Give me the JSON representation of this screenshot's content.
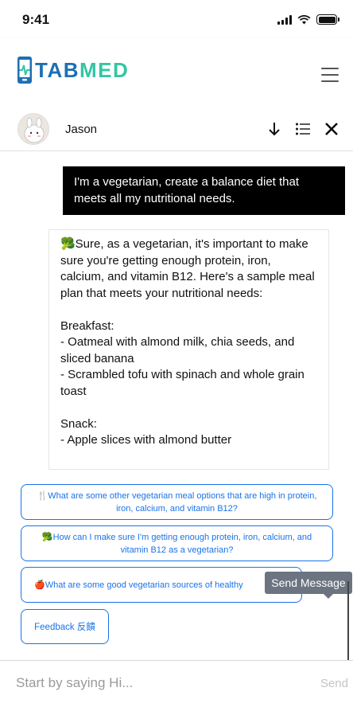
{
  "status_bar": {
    "time": "9:41"
  },
  "app": {
    "logo_part1": "TAB",
    "logo_part2": "MED",
    "brand_blue": "#1e6fb3",
    "brand_green": "#33c5a6"
  },
  "chat_header": {
    "name": "Jason",
    "icons": [
      "arrow-down-icon",
      "list-icon",
      "close-icon"
    ]
  },
  "messages": {
    "user": "I'm a vegetarian, create a balance diet that meets all my nutritional needs.",
    "bot": "🥦Sure, as a vegetarian, it's important to make sure you're getting enough protein, iron, calcium, and vitamin B12. Here's a sample meal plan that meets your nutritional needs:\n\nBreakfast:\n- Oatmeal with almond milk, chia seeds, and sliced banana\n- Scrambled tofu with spinach and whole grain toast\n\nSnack:\n- Apple slices with almond butter"
  },
  "suggestions": [
    {
      "icon": "🍴",
      "text": "What are some other vegetarian meal options that are high in protein, iron, calcium, and vitamin B12?"
    },
    {
      "icon": "🥦",
      "text": "How can I make sure I'm getting enough protein, iron, calcium, and vitamin B12 as a vegetarian?"
    },
    {
      "icon": "🍎",
      "text": "What are some good vegetarian sources of healthy"
    }
  ],
  "feedback_label": "Feedback 反饋",
  "tooltip": "Send Message",
  "input": {
    "placeholder": "Start by saying Hi...",
    "value": ""
  },
  "send_label": "Send",
  "colors": {
    "accent": "#1a73e8",
    "user_bubble": "#000000",
    "tooltip_bg": "#6b7480"
  }
}
